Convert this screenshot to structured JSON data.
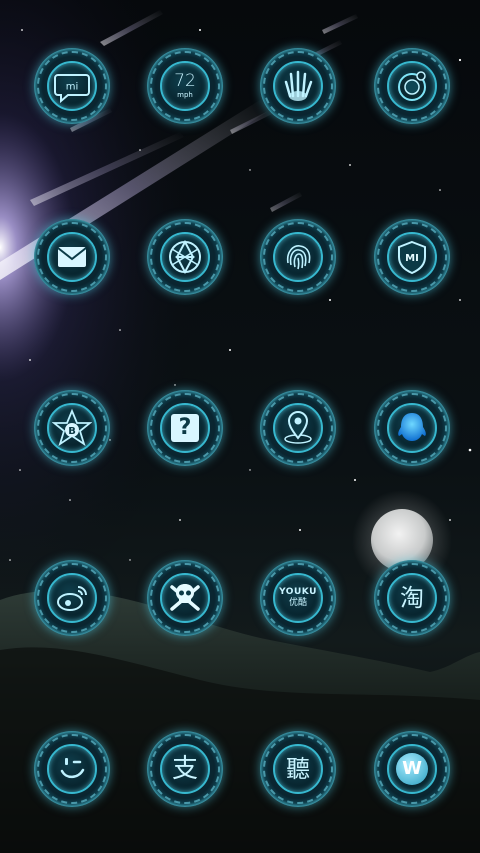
{
  "theme": {
    "accent": "#37b8cf",
    "glow": "#5ad6f0",
    "background": "#05080c"
  },
  "home_screen": {
    "rows": [
      [
        {
          "name": "mi-chat-icon",
          "label": "mi"
        },
        {
          "name": "speedometer-icon",
          "value": "72",
          "unit": "mph"
        },
        {
          "name": "hand-scan-icon"
        },
        {
          "name": "camera-icon"
        }
      ],
      [
        {
          "name": "mail-icon"
        },
        {
          "name": "aperture-icon"
        },
        {
          "name": "fingerprint-icon"
        },
        {
          "name": "mi-shield-icon",
          "label": "MI"
        }
      ],
      [
        {
          "name": "star-b-icon",
          "label": "B"
        },
        {
          "name": "question-icon",
          "label": "?"
        },
        {
          "name": "map-pin-icon"
        },
        {
          "name": "qq-penguin-icon"
        }
      ],
      [
        {
          "name": "weibo-icon"
        },
        {
          "name": "skull-icon"
        },
        {
          "name": "youku-icon",
          "label": "YOUKU",
          "sublabel": "优酷"
        },
        {
          "name": "taobao-icon",
          "label": "淘"
        }
      ],
      [
        {
          "name": "wink-face-icon"
        },
        {
          "name": "alipay-icon",
          "label": "支"
        },
        {
          "name": "listen-icon",
          "label": "聽"
        },
        {
          "name": "w-logo-icon",
          "label": "W"
        }
      ]
    ]
  }
}
